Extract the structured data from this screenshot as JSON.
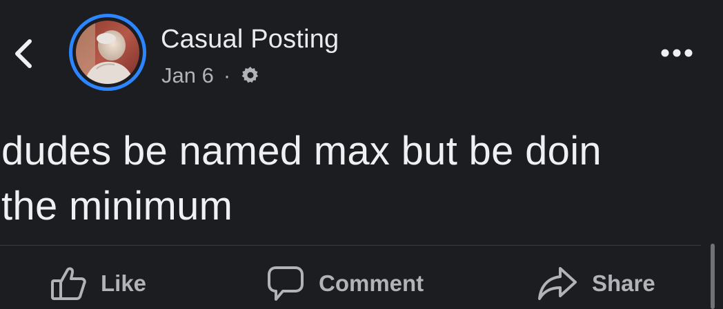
{
  "post": {
    "author": "Casual Posting",
    "date": "Jan 6",
    "separator": "·",
    "privacy_icon": "gear-icon",
    "text_line_1": "dudes be named max but be doin",
    "text_line_2": "the minimum"
  },
  "actions": {
    "like_label": "Like",
    "comment_label": "Comment",
    "share_label": "Share"
  },
  "icons": {
    "back": "chevron-left-icon",
    "more": "more-horizontal-icon",
    "like": "thumbs-up-icon",
    "comment": "speech-bubble-icon",
    "share": "share-arrow-icon"
  },
  "colors": {
    "background": "#1c1d20",
    "story_ring": "#2d86ff",
    "primary_text": "#e9ebee",
    "secondary_text": "#b0b3b8"
  }
}
